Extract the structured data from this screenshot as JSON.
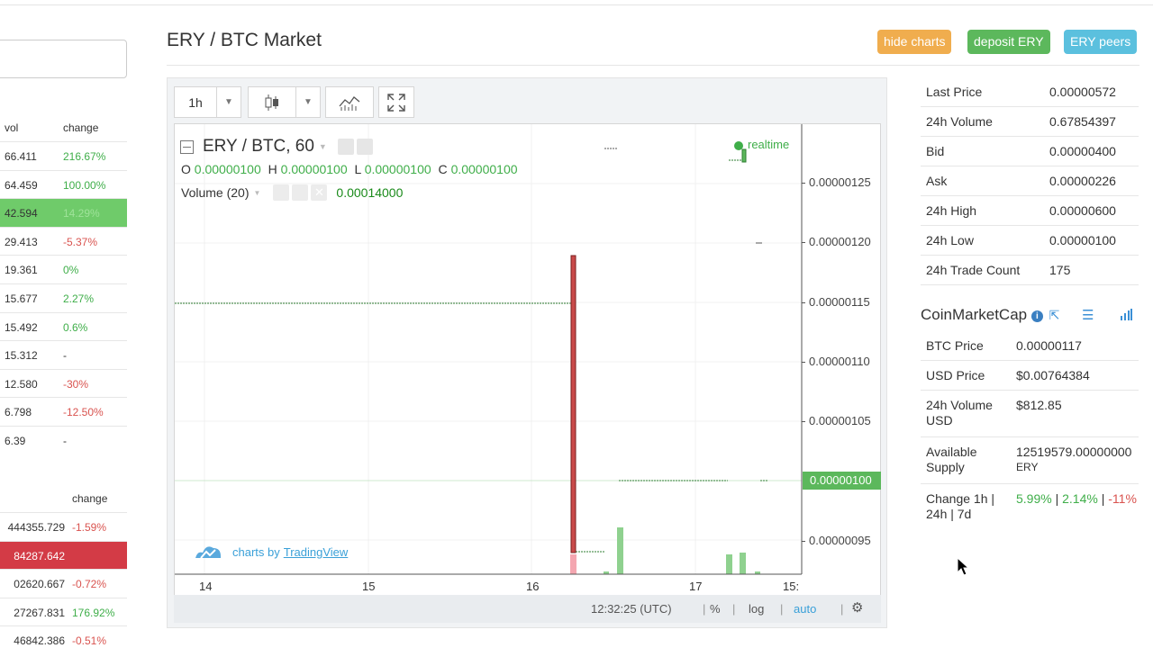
{
  "market_list": {
    "top_headers": {
      "vol": "vol",
      "change": "change"
    },
    "rows": [
      {
        "vol": "66.411",
        "change": "216.67%",
        "cls": "pos"
      },
      {
        "vol": "64.459",
        "change": "100.00%",
        "cls": "pos"
      },
      {
        "vol": "42.594",
        "change": "14.29%",
        "cls": "pos",
        "highlight": "green"
      },
      {
        "vol": "29.413",
        "change": "-5.37%",
        "cls": "neg"
      },
      {
        "vol": "19.361",
        "change": "0%",
        "cls": "pos"
      },
      {
        "vol": "15.677",
        "change": "2.27%",
        "cls": "pos"
      },
      {
        "vol": "15.492",
        "change": "0.6%",
        "cls": "pos"
      },
      {
        "vol": "15.312",
        "change": "-",
        "cls": "neu"
      },
      {
        "vol": "12.580",
        "change": "-30%",
        "cls": "neg"
      },
      {
        "vol": "6.798",
        "change": "-12.50%",
        "cls": "neg"
      },
      {
        "vol": "6.39",
        "change": "-",
        "cls": "neu"
      }
    ],
    "bottom_headers": {
      "change": "change"
    },
    "bottom_rows": [
      {
        "vol": "444355.729",
        "change": "-1.59%",
        "cls": "neg"
      },
      {
        "vol": "84287.642",
        "change": "",
        "cls": "neg",
        "highlight": "red"
      },
      {
        "vol": "02620.667",
        "change": "-0.72%",
        "cls": "neg"
      },
      {
        "vol": "27267.831",
        "change": "176.92%",
        "cls": "pos"
      },
      {
        "vol": "46842.386",
        "change": "-0.51%",
        "cls": "neg"
      }
    ]
  },
  "header": {
    "title": "ERY / BTC Market",
    "buttons": {
      "hide_charts": "hide charts",
      "deposit": "deposit ERY",
      "peers": "ERY peers"
    }
  },
  "chart": {
    "interval": "1h",
    "legend_title": "ERY / BTC, 60",
    "ohlc": {
      "o_label": "O",
      "o": "0.00000100",
      "h_label": "H",
      "h": "0.00000100",
      "l_label": "L",
      "l": "0.00000100",
      "c_label": "C",
      "c": "0.00000100"
    },
    "volume_label": "Volume (20)",
    "volume_value": "0.00014000",
    "realtime": "realtime",
    "price_ticks": [
      "0.00000125",
      "0.00000120",
      "0.00000115",
      "0.00000110",
      "0.00000105",
      "0.00000095"
    ],
    "current_price": "0.00000100",
    "x_ticks": [
      "14",
      "15",
      "16",
      "17",
      "15:"
    ],
    "branding_prefix": "charts by",
    "branding_link": "TradingView",
    "time": "12:32:25 (UTC)",
    "percent": "%",
    "log": "log",
    "auto": "auto"
  },
  "stats": [
    {
      "k": "Last Price",
      "v": "0.00000572",
      "cls": "neg"
    },
    {
      "k": "24h Volume",
      "v": "0.67854397",
      "cls": "neu"
    },
    {
      "k": "Bid",
      "v": "0.00000400",
      "cls": "neg"
    },
    {
      "k": "Ask",
      "v": "0.00000226",
      "cls": "neu"
    },
    {
      "k": "24h High",
      "v": "0.00000600",
      "cls": "neu"
    },
    {
      "k": "24h Low",
      "v": "0.00000100",
      "cls": "neu"
    },
    {
      "k": "24h Trade Count",
      "v": "175",
      "cls": "neu"
    }
  ],
  "cmc": {
    "title": "CoinMarketCap",
    "btc_price_k": "BTC Price",
    "btc_price_v": "0.00000117",
    "usd_price_k": "USD Price",
    "usd_price_v": "$0.00764384",
    "vol_k1": "24h Volume",
    "vol_k2": "USD",
    "vol_v": "$812.85",
    "supply_k1": "Available",
    "supply_k2": "Supply",
    "supply_v1": "12519579.00000000",
    "supply_v2": "ERY",
    "change_k1": "Change 1h |",
    "change_k2": "24h | 7d",
    "change_1h": "5.99%",
    "sep1": " | ",
    "change_24h": "2.14%",
    "sep2": " | ",
    "change_7d": "-11%"
  },
  "colors": {
    "positive": "#3fae49",
    "negative": "#d9534f",
    "hide_charts_btn": "#f0ad4e",
    "deposit_btn": "#5cb85c",
    "peers_btn": "#5bc0de"
  }
}
